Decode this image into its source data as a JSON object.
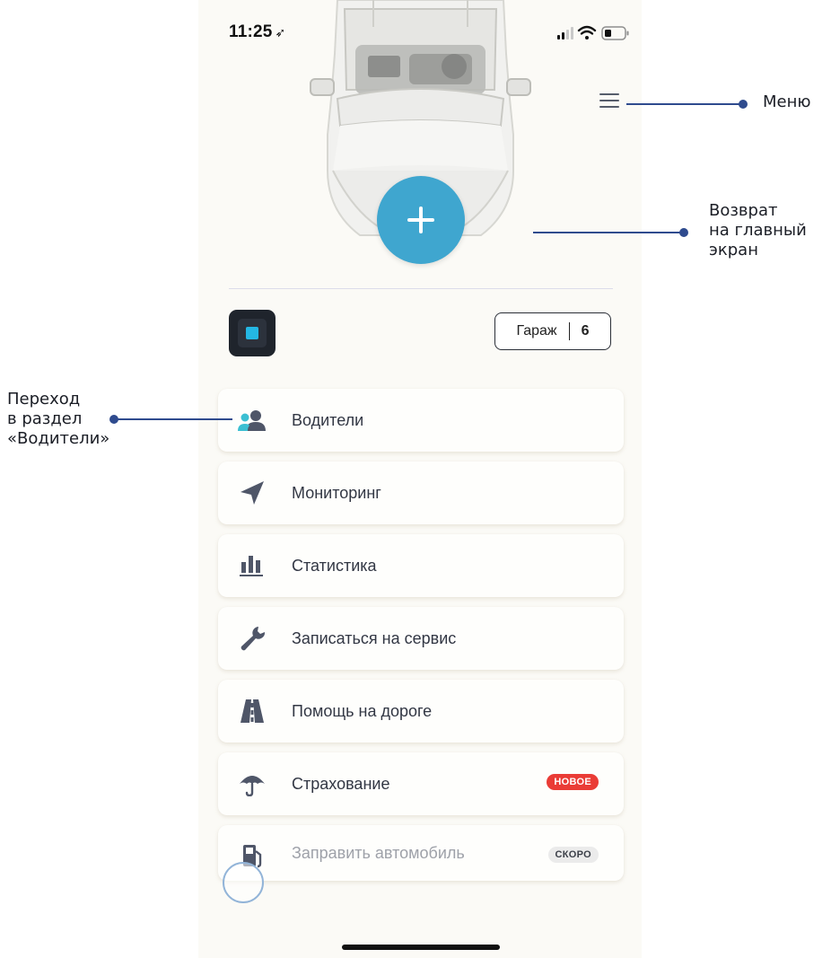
{
  "status_bar": {
    "time": "11:25",
    "location_arrow": "navigation-arrow-icon",
    "icons": [
      "signal-icon",
      "wifi-icon",
      "battery-icon"
    ]
  },
  "header": {
    "menu_icon": "hamburger-icon",
    "add_icon": "plus-icon"
  },
  "garage": {
    "label": "Гараж",
    "count": "6"
  },
  "menu_items": [
    {
      "label": "Водители",
      "icon": "users-icon"
    },
    {
      "label": "Мониторинг",
      "icon": "navigation-icon"
    },
    {
      "label": "Статистика",
      "icon": "bar-chart-icon"
    },
    {
      "label": "Записаться на сервис",
      "icon": "wrench-icon"
    },
    {
      "label": "Помощь на дороге",
      "icon": "road-icon"
    },
    {
      "label": "Страхование",
      "icon": "umbrella-icon",
      "badge": "НОВОЕ"
    },
    {
      "label": "Заправить автомобиль",
      "icon": "fuel-icon",
      "badge": "СКОРО",
      "disabled": true
    }
  ],
  "annotations": {
    "menu": "Меню",
    "home": [
      "Возврат",
      "на главный",
      "экран"
    ],
    "drivers": [
      "Переход",
      "в раздел",
      "«Водители»"
    ]
  },
  "colors": {
    "accent": "#3fa6cf",
    "annotation_line": "#2f4b8e",
    "badge_new": "#ea3c36",
    "badge_soon": "#ebebeb",
    "background": "#fbfaf6"
  }
}
